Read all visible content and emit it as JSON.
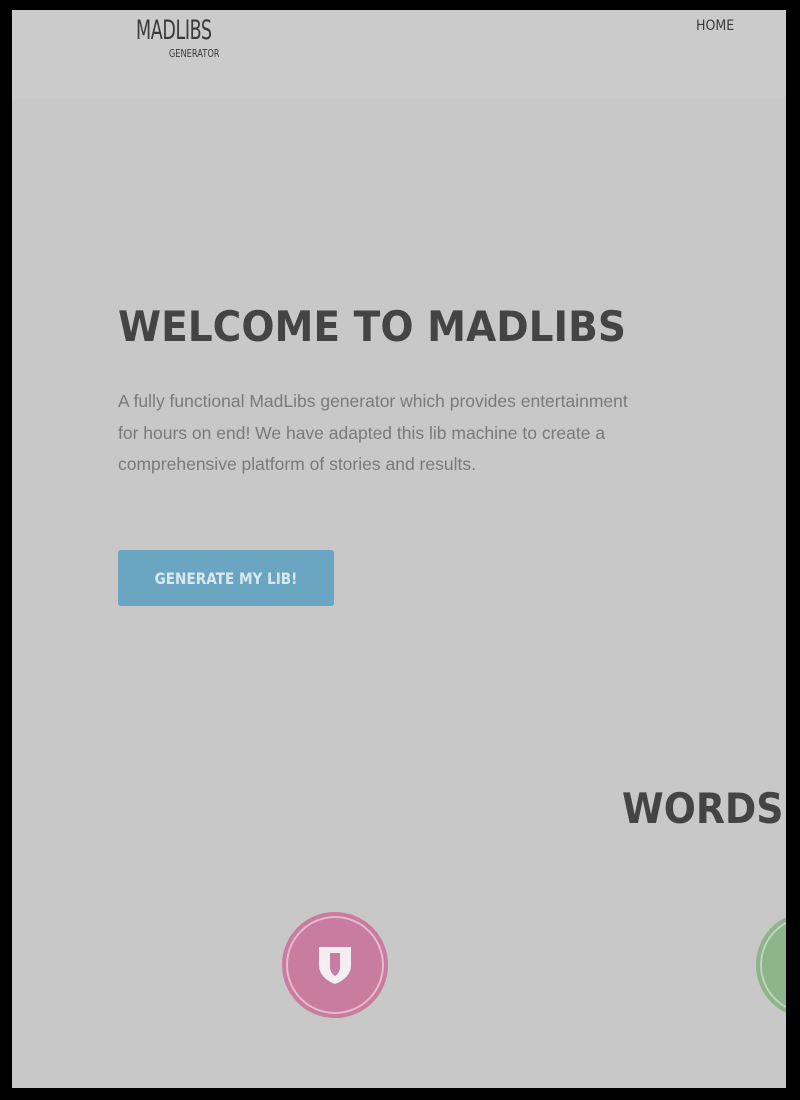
{
  "header": {
    "logo_main": "MADLIBS",
    "logo_sub": "GENERATOR",
    "nav_home": "HOME"
  },
  "hero": {
    "title": "WELCOME TO MADLIBS",
    "description": "A fully functional MadLibs generator which provides entertainment for hours on end! We have adapted this lib machine to create a comprehensive platform of stories and results.",
    "cta_label": "GENERATE MY LIB!"
  },
  "section": {
    "title_partial": "WORDS C"
  },
  "icons": [
    {
      "name": "shield-icon",
      "color": "#c87ca0"
    },
    {
      "name": "feature-icon",
      "color": "#8db48b"
    }
  ],
  "colors": {
    "page_bg": "#c8c8c8",
    "cta": "#6aa5c1",
    "heading": "#444444",
    "body_text": "#7a7a7a"
  }
}
